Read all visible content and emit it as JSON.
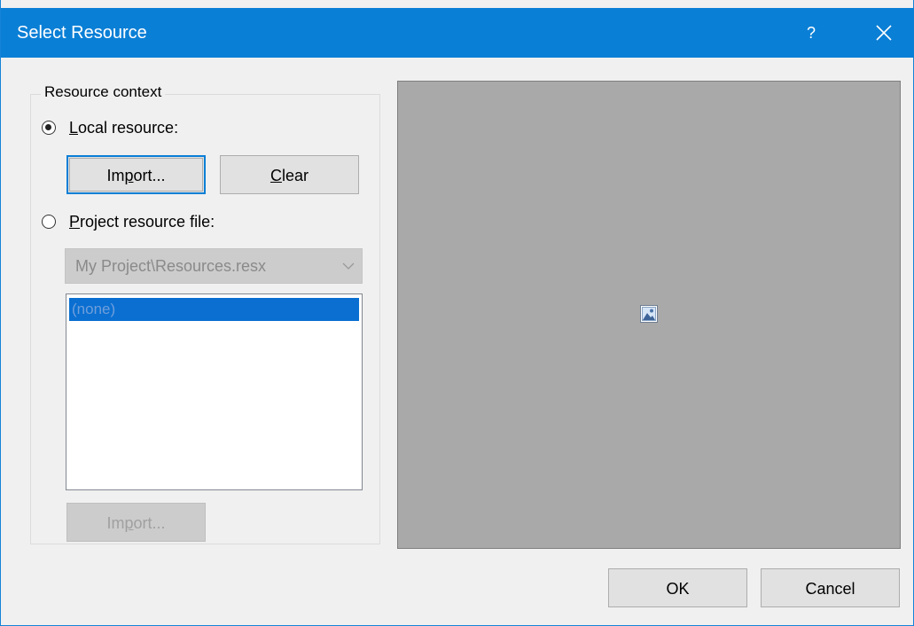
{
  "dialog": {
    "title": "Select Resource",
    "help_label": "?",
    "accent_color": "#0a7fd6"
  },
  "resource_context": {
    "legend": "Resource context",
    "local_resource": {
      "label_prefix": "",
      "label_mnemonic": "L",
      "label_suffix": "ocal resource:",
      "selected": true
    },
    "import_button": {
      "prefix": "Im",
      "mnemonic": "p",
      "suffix": "ort..."
    },
    "clear_button": {
      "prefix": "",
      "mnemonic": "C",
      "suffix": "lear"
    },
    "project_resource": {
      "label_prefix": "",
      "label_mnemonic": "P",
      "label_suffix": "roject resource file:",
      "selected": false
    },
    "resource_file_combo": {
      "value": "My Project\\Resources.resx"
    },
    "resource_list": {
      "items": [
        "(none)"
      ],
      "selected_index": 0
    },
    "project_import_button": {
      "prefix": "Im",
      "mnemonic": "p",
      "suffix": "ort..."
    }
  },
  "preview": {
    "background_color": "#a9a9a9",
    "icon": "image-placeholder-icon"
  },
  "footer": {
    "ok_label": "OK",
    "cancel_label": "Cancel"
  }
}
